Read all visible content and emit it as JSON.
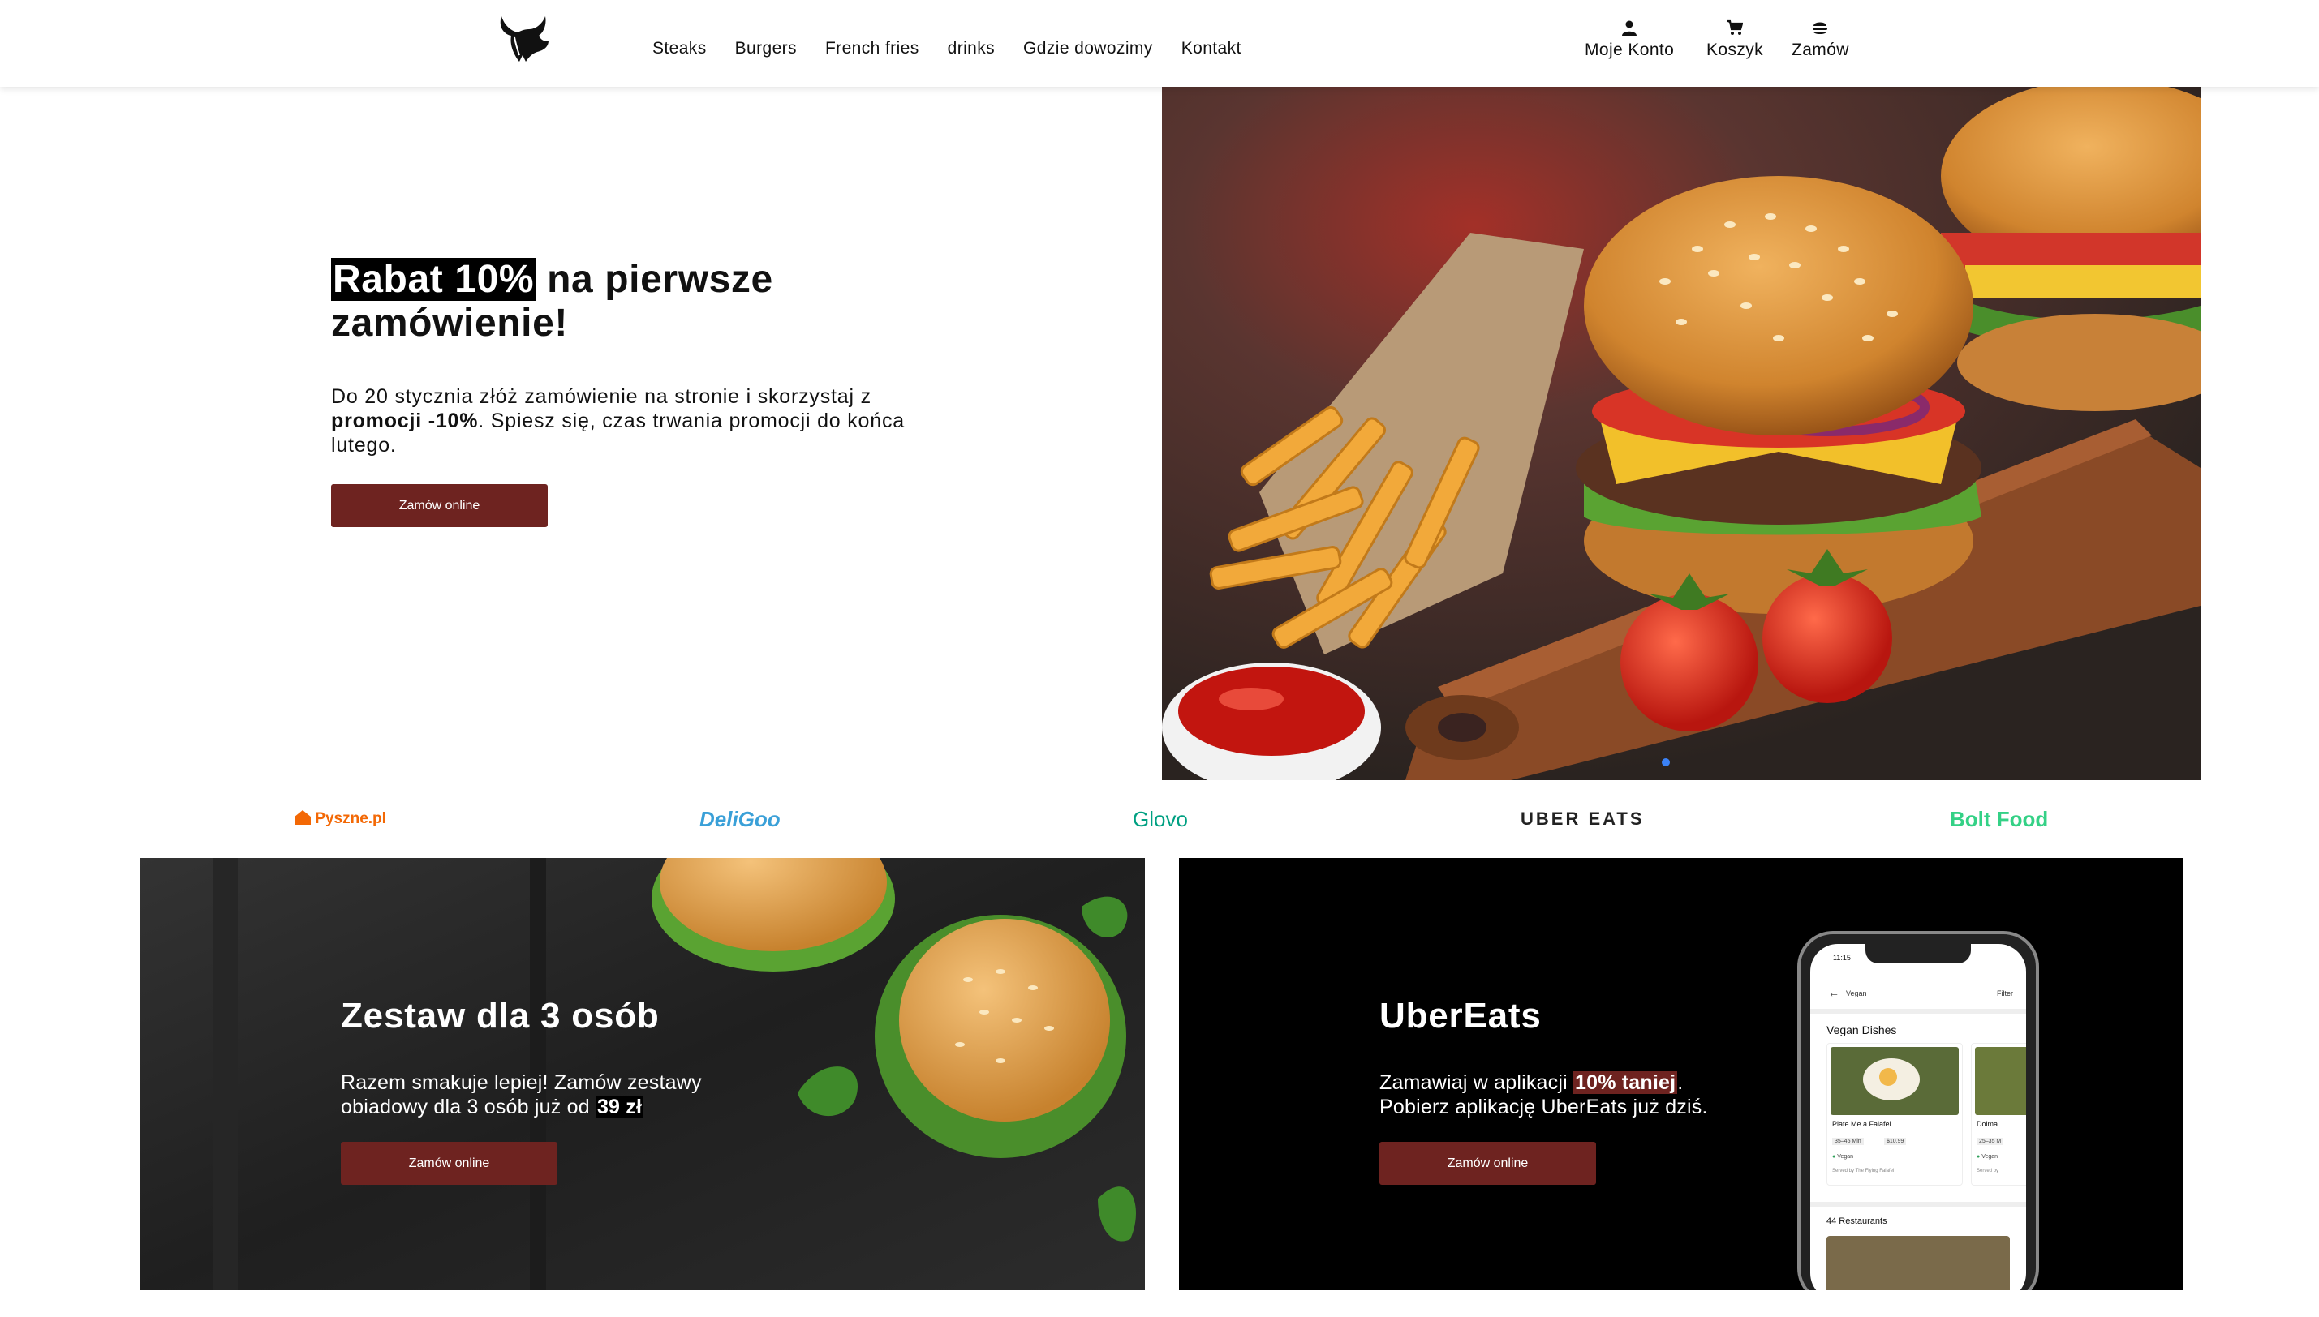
{
  "header": {
    "nav": [
      {
        "label": "Steaks"
      },
      {
        "label": "Burgers"
      },
      {
        "label": "French fries"
      },
      {
        "label": "drinks"
      },
      {
        "label": "Gdzie dowozimy"
      },
      {
        "label": "Kontakt"
      }
    ],
    "account": {
      "label": "Moje Konto",
      "icon": "user-icon"
    },
    "cart": {
      "label": "Koszyk",
      "icon": "cart-icon"
    },
    "order": {
      "label": "Zamów",
      "icon": "burger-icon"
    }
  },
  "hero": {
    "title_highlight": "Rabat 10%",
    "title_rest": " na pierwsze zamówienie!",
    "desc_part1": "Do 20 stycznia złóż zamówienie na stronie i skorzystaj z ",
    "desc_bold": "promocji -10%",
    "desc_part2": ". Spiesz się, czas trwania promocji do końca lutego.",
    "button": "Zamów online",
    "slider_active": 1
  },
  "partners": [
    {
      "name": "Pyszne.pl",
      "color": "#f36805"
    },
    {
      "name": "DeliGoo",
      "color": "#3aa0d8"
    },
    {
      "name": "Glovo",
      "color": "#00a082"
    },
    {
      "name": "UBER EATS",
      "color": "#222222"
    },
    {
      "name": "Bolt Food",
      "color": "#34d186"
    }
  ],
  "cards": [
    {
      "title": "Zestaw dla 3 osób",
      "desc_part1": "Razem smakuje lepiej! Zamów zestawy obiadowy dla 3 osób już od ",
      "desc_bold": "39 zł",
      "button": "Zamów online"
    },
    {
      "title": "UberEats",
      "desc_part1": "Zamawiaj w aplikacji ",
      "desc_bold": "10% taniej",
      "desc_part2": ". Pobierz aplikację UberEats już dziś.",
      "button": "Zamów online",
      "phone": {
        "time": "11:15",
        "back_label": "Vegan",
        "filter_label": "Filter",
        "section_title": "Vegan Dishes",
        "dish1_name": "Plate Me a Falafel",
        "dish1_time": "35–45 Min",
        "dish1_price": "$10.99",
        "dish1_tag": "Vegan",
        "dish1_by": "Served by The Flying Falafel",
        "dish2_name": "Dolma",
        "dish2_time": "25–35 M",
        "dish2_tag": "Vegan",
        "dish2_by": "Served by",
        "restaurants": "44 Restaurants"
      }
    }
  ],
  "colors": {
    "brand": "#6e2320",
    "highlight": "#000000",
    "slider_dot": "#3b82f6"
  }
}
